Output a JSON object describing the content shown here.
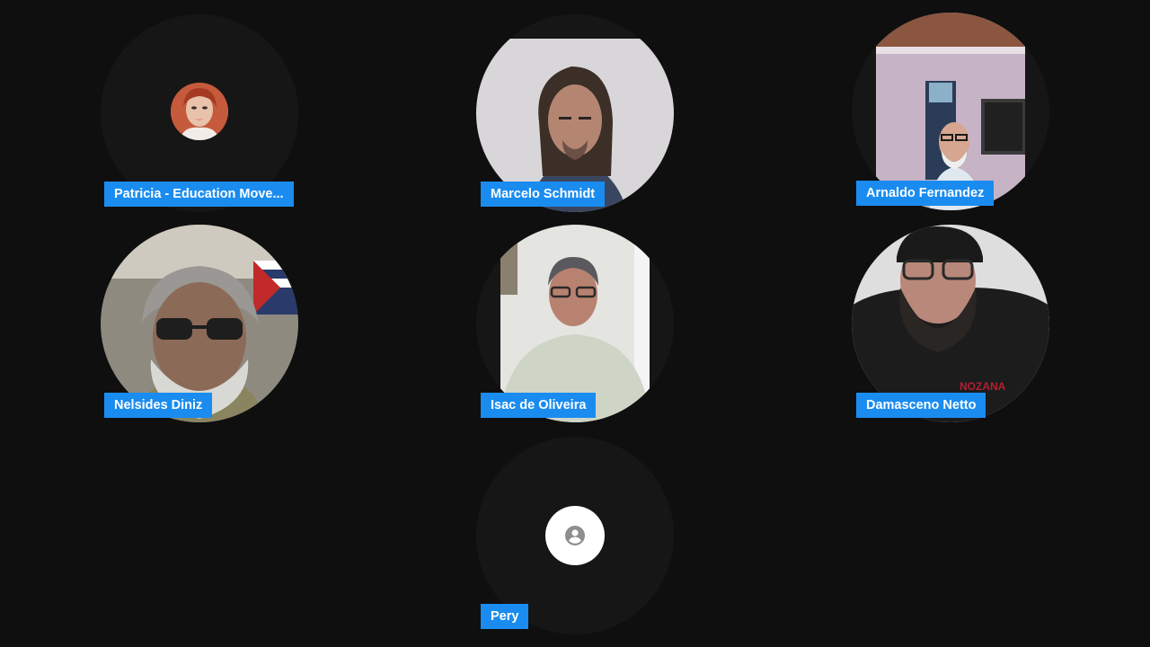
{
  "participants": [
    {
      "name": "Patricia - Education Move...",
      "camera": "avatar-photo"
    },
    {
      "name": "Marcelo Schmidt",
      "camera": "video"
    },
    {
      "name": "Arnaldo Fernandez",
      "camera": "video"
    },
    {
      "name": "Nelsides Diniz",
      "camera": "video"
    },
    {
      "name": "Isac de Oliveira",
      "camera": "video"
    },
    {
      "name": "Damasceno Netto",
      "camera": "video"
    },
    {
      "name": "Pery",
      "camera": "off",
      "icon": "person-icon"
    }
  ],
  "colors": {
    "background": "#0f0f0f",
    "tile_bubble": "#161616",
    "name_tag": "#1a8cf0",
    "name_text": "#ffffff"
  }
}
